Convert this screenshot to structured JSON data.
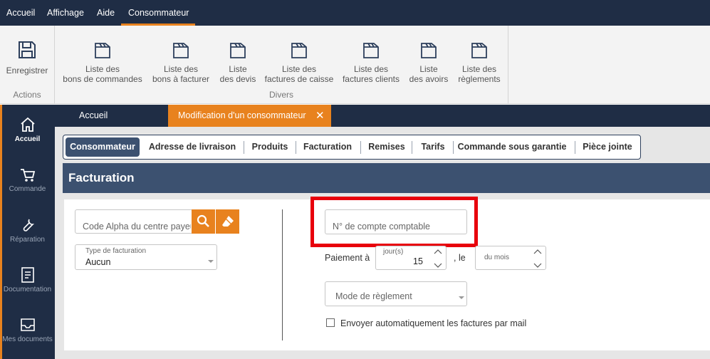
{
  "menu": {
    "items": [
      "Accueil",
      "Affichage",
      "Aide",
      "Consommateur"
    ]
  },
  "ribbon": {
    "save_label": "Enregistrer",
    "actions_group": "Actions",
    "divers_group": "Divers",
    "buttons": [
      {
        "line1": "Liste des",
        "line2": "bons de commandes"
      },
      {
        "line1": "Liste des",
        "line2": "bons à facturer"
      },
      {
        "line1": "Liste",
        "line2": "des devis"
      },
      {
        "line1": "Liste des",
        "line2": "factures de caisse"
      },
      {
        "line1": "Liste des",
        "line2": "factures clients"
      },
      {
        "line1": "Liste",
        "line2": "des avoirs"
      },
      {
        "line1": "Liste des",
        "line2": "règlements"
      }
    ]
  },
  "nav": {
    "items": [
      "Accueil",
      "Commande",
      "Réparation",
      "Documentation",
      "Mes documents"
    ]
  },
  "doc_tabs": {
    "home": "Accueil",
    "active": "Modification d'un consommateur",
    "close_glyph": "✕"
  },
  "subtabs": [
    "Consommateur",
    "Adresse de livraison",
    "Produits",
    "Facturation",
    "Remises",
    "Tarifs",
    "Commande sous garantie",
    "Pièce jointe"
  ],
  "section": {
    "title": "Facturation"
  },
  "form": {
    "code_alpha_placeholder": "Code Alpha du centre payeur",
    "type_facturation_label": "Type de facturation",
    "type_facturation_value": "Aucun",
    "compte_comptable_placeholder": "N° de compte comptable",
    "paiement_label": "Paiement à",
    "jours_label": "jour(s)",
    "jours_value": "15",
    "le_label": ", le",
    "du_mois_label": "du mois",
    "mode_reglement_placeholder": "Mode de règlement",
    "envoyer_label": "Envoyer automatiquement les factures par mail"
  },
  "colors": {
    "navy": "#1f2d45",
    "header_blue": "#3c5170",
    "accent_orange": "#e8821e",
    "highlight_red": "#e8000c"
  }
}
